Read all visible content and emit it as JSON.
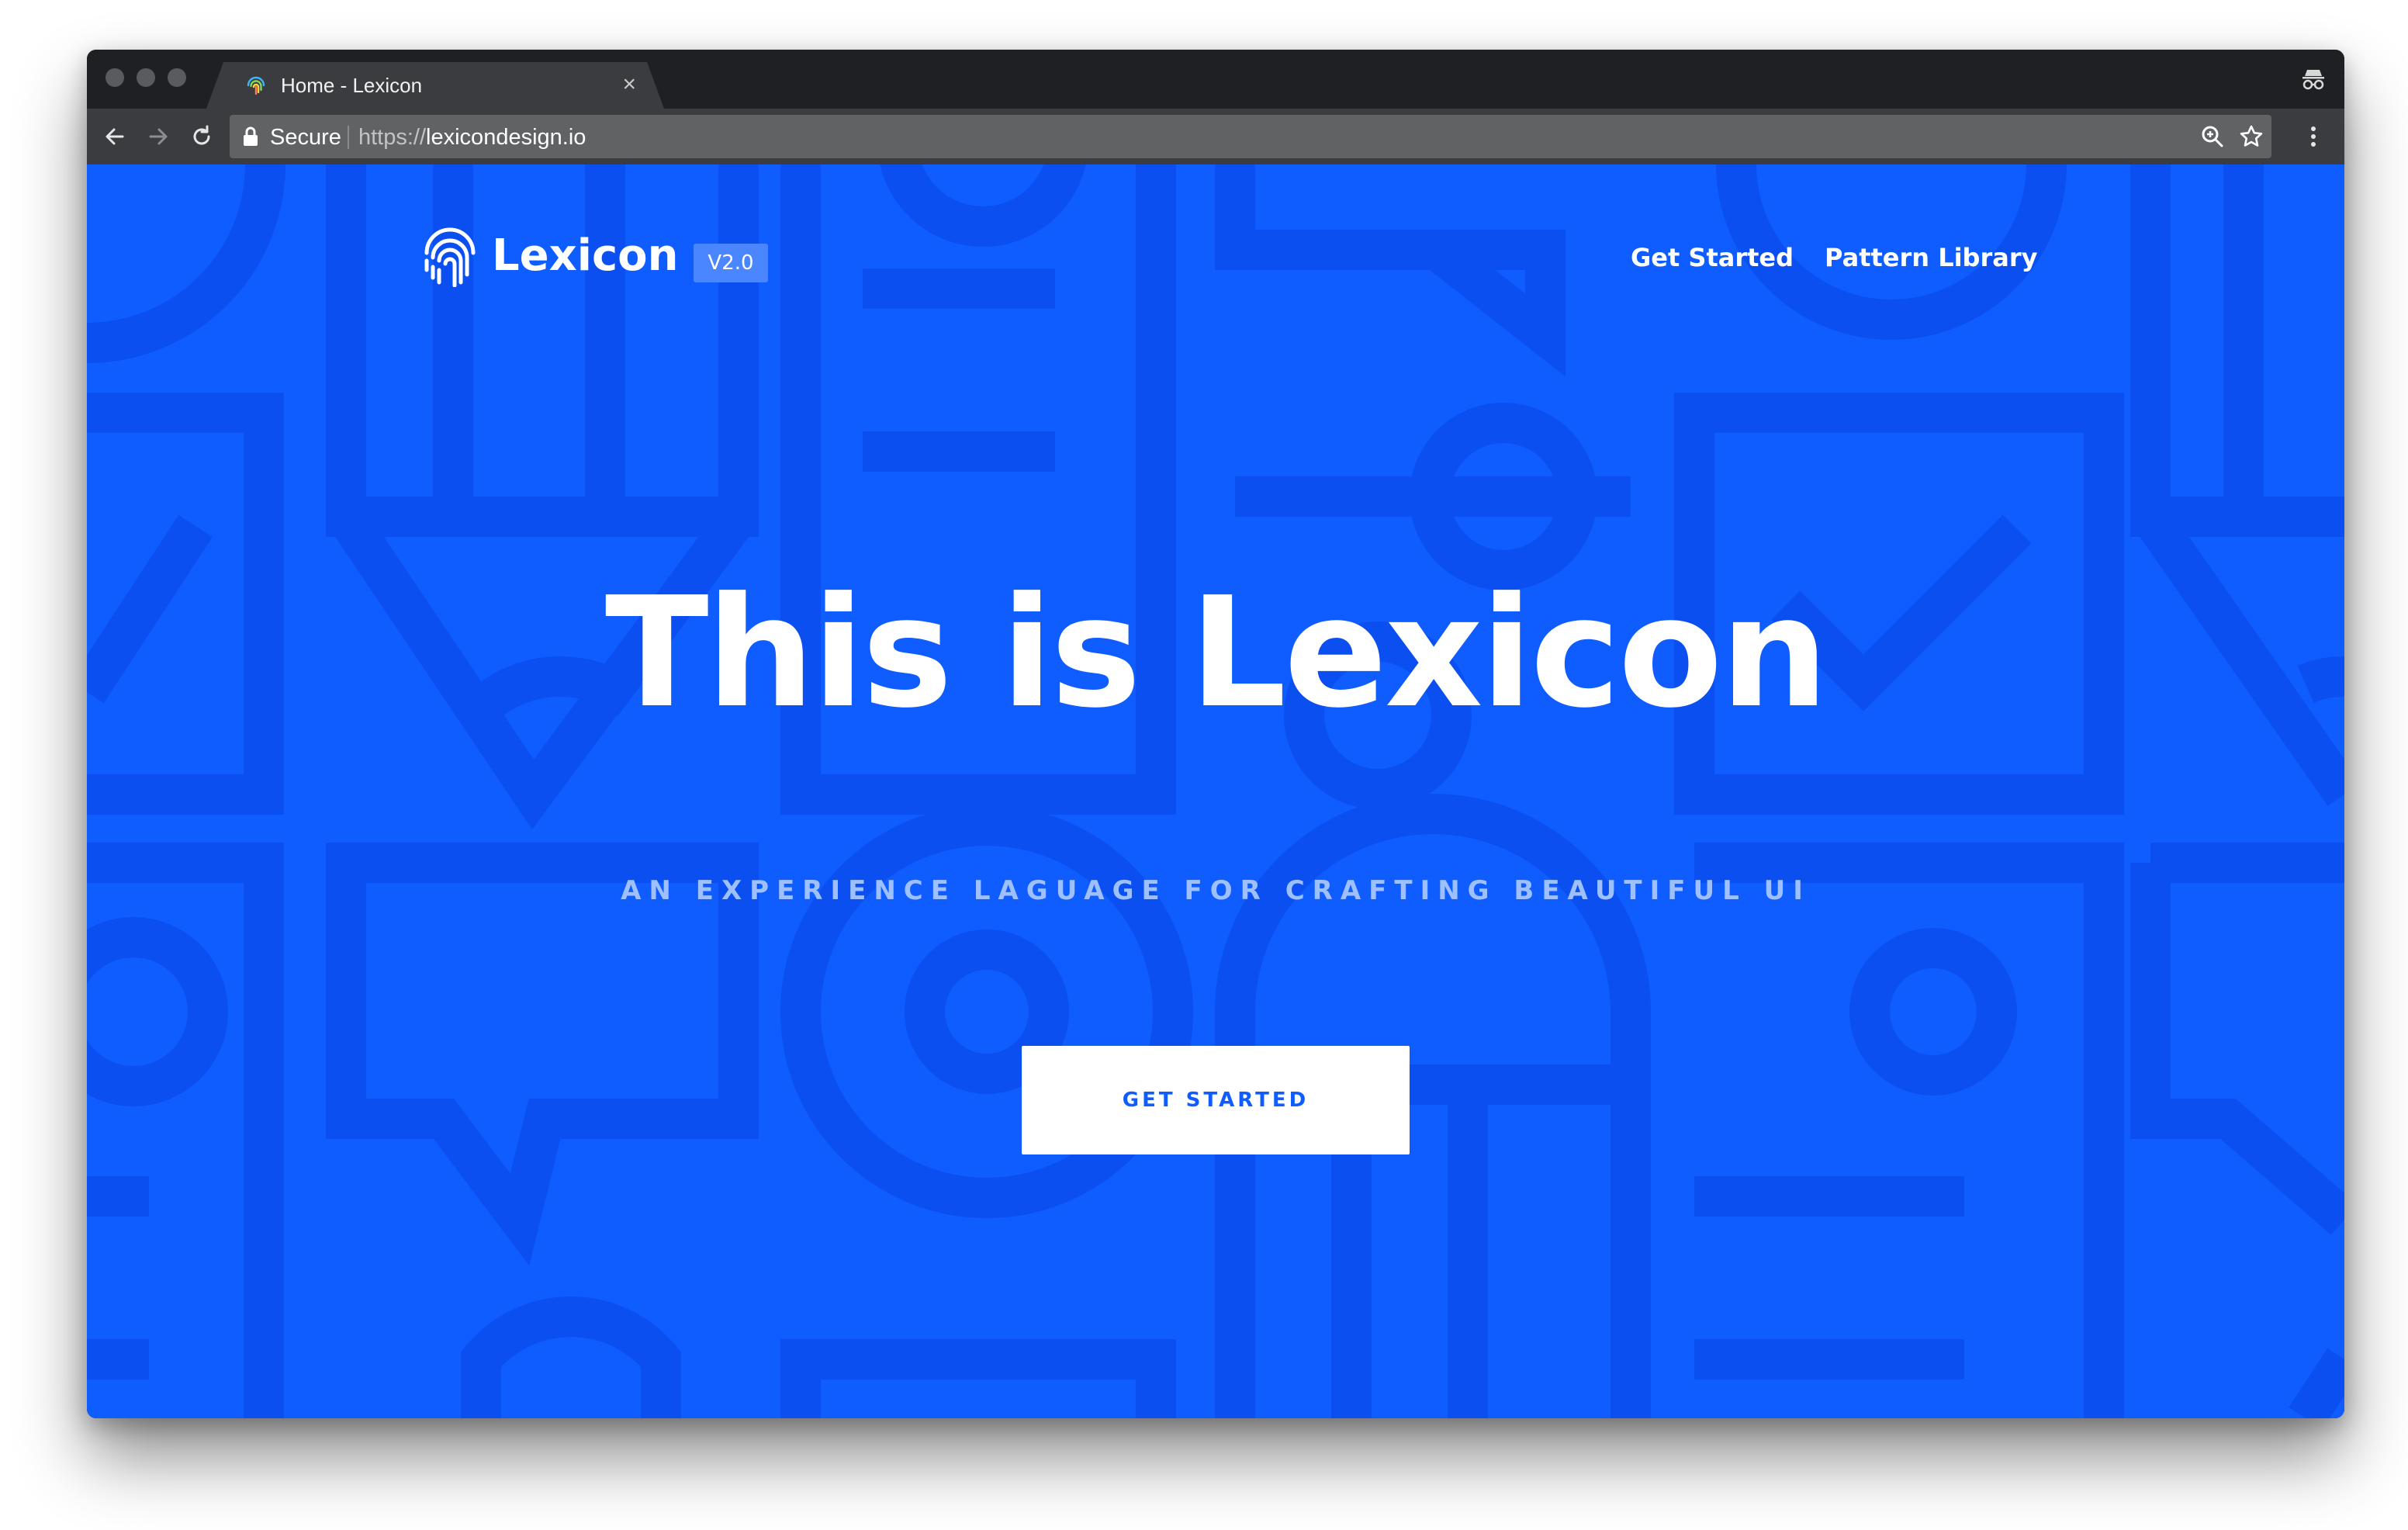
{
  "browser": {
    "tab": {
      "title": "Home - Lexicon",
      "close_glyph": "×",
      "favicon_icon": "fingerprint-icon"
    },
    "toolbar": {
      "back_icon": "back-arrow-icon",
      "forward_icon": "forward-arrow-icon",
      "reload_icon": "reload-icon",
      "secure_label": "Secure",
      "url_scheme": "https://",
      "url_host": "lexicondesign.io",
      "zoom_icon": "zoom-icon",
      "bookmark_icon": "star-icon",
      "menu_icon": "kebab-menu-icon"
    },
    "incognito_icon": "incognito-icon"
  },
  "site": {
    "brand": {
      "name": "Lexicon",
      "version": "V2.0",
      "logo_icon": "fingerprint-icon"
    },
    "nav": [
      {
        "label": "Get Started"
      },
      {
        "label": "Pattern Library"
      }
    ],
    "hero": {
      "title": "This is Lexicon",
      "subtitle": "AN EXPERIENCE LAGUAGE FOR CRAFTING BEAUTIFUL UI",
      "cta_label": "GET STARTED"
    }
  },
  "colors": {
    "page_background": "#0f5cff",
    "pattern_stroke": "#0b4ff0",
    "badge_background": "#4a86ff",
    "subtitle": "#9fc0ff",
    "cta_text": "#0f5cff"
  }
}
